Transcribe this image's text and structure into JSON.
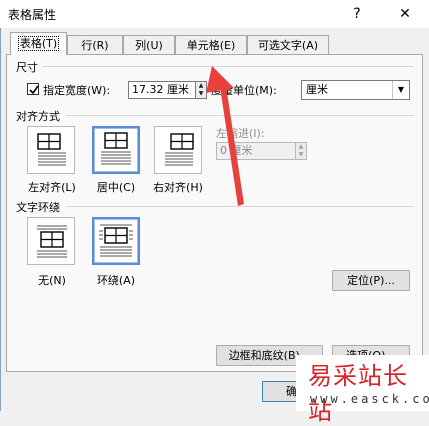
{
  "window": {
    "title": "表格属性",
    "help": "?",
    "close": "✕"
  },
  "tabs": [
    {
      "label": "表格(T)",
      "active": true
    },
    {
      "label": "行(R)",
      "active": false
    },
    {
      "label": "列(U)",
      "active": false
    },
    {
      "label": "单元格(E)",
      "active": false
    },
    {
      "label": "可选文字(A)",
      "active": false
    }
  ],
  "size": {
    "section": "尺寸",
    "preferred_width_label": "指定宽度(W):",
    "preferred_width_checked": true,
    "width_value": "17.32 厘米",
    "measure_label": "度量单位(M):",
    "measure_value": "厘米"
  },
  "alignment": {
    "section": "对齐方式",
    "options": [
      "左对齐(L)",
      "居中(C)",
      "右对齐(H)"
    ],
    "selected": 1,
    "indent_label": "左缩进(I):",
    "indent_value": "0 厘米"
  },
  "wrapping": {
    "section": "文字环绕",
    "options": [
      "无(N)",
      "环绕(A)"
    ],
    "selected": 1,
    "positioning_button": "定位(P)..."
  },
  "buttons": {
    "borders_shading": "边框和底纹(B)...",
    "options": "选项(O)...",
    "ok": "确定"
  },
  "watermark": {
    "text": "易采站长站",
    "url": "www.easck.com"
  },
  "colors": {
    "accent": "#5a8cd0",
    "arrow": "#e8403c",
    "watermark": "#d8252c"
  }
}
